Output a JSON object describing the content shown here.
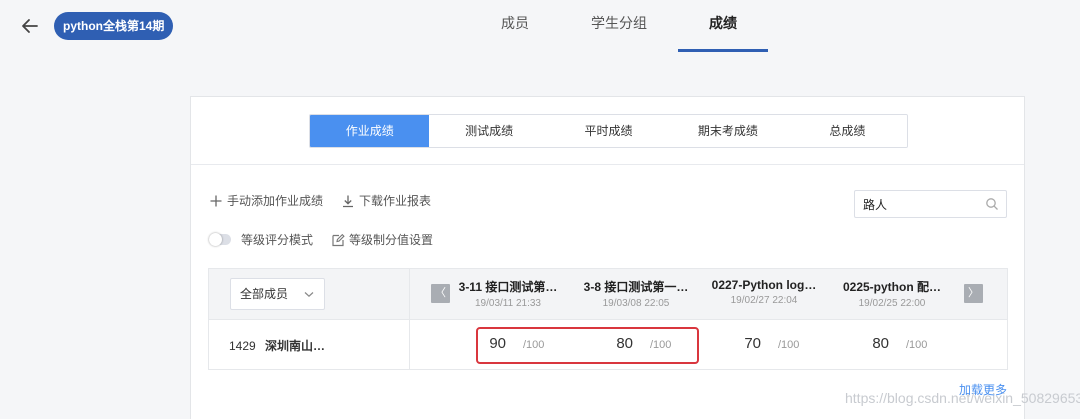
{
  "header": {
    "course_badge": "python全栈第14期",
    "tabs": [
      {
        "label": "成员"
      },
      {
        "label": "学生分组"
      },
      {
        "label": "成绩"
      }
    ]
  },
  "grades": {
    "segments": [
      {
        "label": "作业成绩"
      },
      {
        "label": "测试成绩"
      },
      {
        "label": "平时成绩"
      },
      {
        "label": "期末考成绩"
      },
      {
        "label": "总成绩"
      }
    ],
    "toolbar": {
      "add_label": "手动添加作业成绩",
      "download_label": "下载作业报表",
      "grade_mode_label": "等级评分模式",
      "grade_settings_label": "等级制分值设置"
    },
    "search": {
      "value": "路人"
    },
    "table": {
      "member_filter": "全部成员",
      "prev_glyph": "〈",
      "next_glyph": "〉",
      "columns": [
        {
          "title": "3-11 接口测试第…",
          "time": "19/03/11 21:33"
        },
        {
          "title": "3-8 接口测试第一…",
          "time": "19/03/08 22:05"
        },
        {
          "title": "0227-Python log…",
          "time": "19/02/27 22:04"
        },
        {
          "title": "0225-python 配…",
          "time": "19/02/25 22:00"
        }
      ],
      "rows": [
        {
          "id": "1429",
          "name": "深圳南山…",
          "scores": [
            {
              "value": "90",
              "max": "/100"
            },
            {
              "value": "80",
              "max": "/100"
            },
            {
              "value": "70",
              "max": "/100"
            },
            {
              "value": "80",
              "max": "/100"
            }
          ]
        }
      ]
    },
    "load_more": "加载更多"
  },
  "watermark": "https://blog.csdn.net/weixin_50829653",
  "colors": {
    "accent": "#4a90f0",
    "badge": "#2f5fb3",
    "highlight_border": "#d9363e"
  }
}
